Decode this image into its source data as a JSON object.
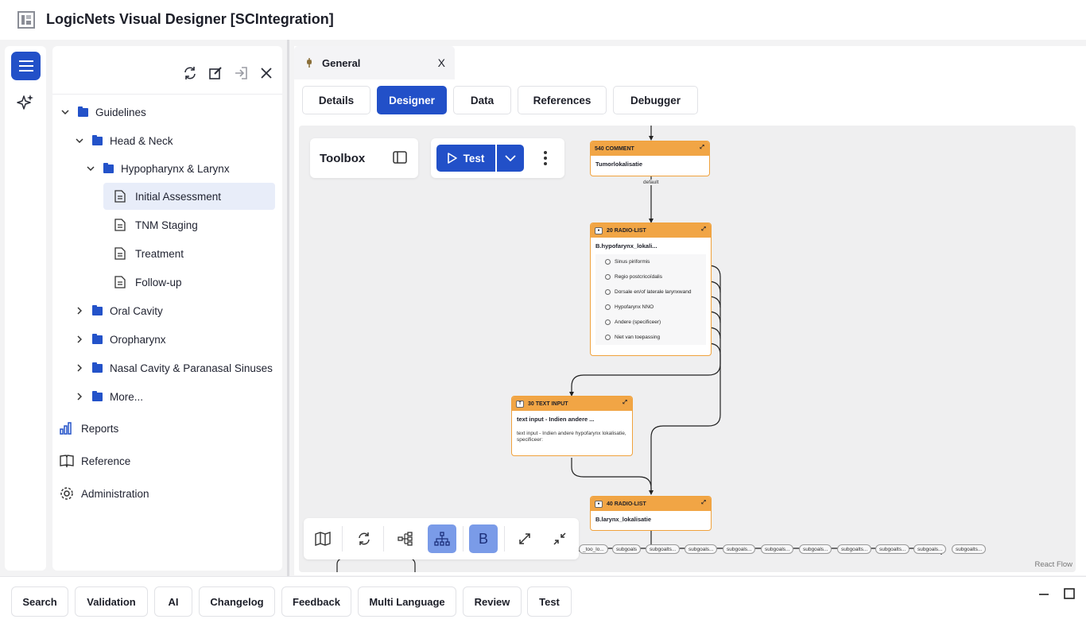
{
  "app": {
    "title": "LogicNets Visual Designer [SCIntegration]",
    "accent_color": "#2250c8",
    "node_color": "#f1a545"
  },
  "rail": {
    "menu_icon": "hamburger-icon",
    "assistant_icon": "sparkle-icon"
  },
  "tree": {
    "actions": [
      "refresh-icon",
      "edit-icon",
      "sign-in-icon",
      "close-icon"
    ],
    "items": [
      {
        "label": "Guidelines",
        "type": "folder",
        "expanded": true,
        "level": 0
      },
      {
        "label": "Head & Neck",
        "type": "folder",
        "expanded": true,
        "level": 1
      },
      {
        "label": "Hypopharynx & Larynx",
        "type": "folder",
        "expanded": true,
        "level": 2
      },
      {
        "label": "Initial Assessment",
        "type": "document",
        "selected": true,
        "level": 3
      },
      {
        "label": "TNM Staging",
        "type": "document",
        "level": 3
      },
      {
        "label": "Treatment",
        "type": "document",
        "level": 3
      },
      {
        "label": "Follow-up",
        "type": "document",
        "level": 3
      },
      {
        "label": "Oral Cavity",
        "type": "folder",
        "expanded": false,
        "level": 1
      },
      {
        "label": "Oropharynx",
        "type": "folder",
        "expanded": false,
        "level": 1
      },
      {
        "label": "Nasal Cavity & Paranasal Sinuses",
        "type": "folder",
        "expanded": false,
        "level": 1
      },
      {
        "label": "More...",
        "type": "folder",
        "expanded": false,
        "level": 1
      }
    ],
    "nav": [
      {
        "label": "Reports",
        "icon": "bar-chart-icon"
      },
      {
        "label": "Reference",
        "icon": "book-icon"
      },
      {
        "label": "Administration",
        "icon": "gear-icon"
      }
    ]
  },
  "editor": {
    "doc_tab": {
      "label": "General",
      "close": "X"
    },
    "subtabs": [
      {
        "label": "Details",
        "active": false
      },
      {
        "label": "Designer",
        "active": true
      },
      {
        "label": "Data",
        "active": false
      },
      {
        "label": "References",
        "active": false
      },
      {
        "label": "Debugger",
        "active": false
      }
    ],
    "toolbox": {
      "label": "Toolbox"
    },
    "test_button": {
      "label": "Test"
    },
    "nodes": {
      "comment": {
        "header": "540 COMMENT",
        "title": "Tumorlokalisatie"
      },
      "radio1": {
        "header": "20 RADIO-LIST",
        "title": "B.hypofarynx_lokali...",
        "options": [
          "Sinus piriformis",
          "Regio postcricoïdalis",
          "Dorsale en/of laterale larynxwand",
          "Hypofarynx NNO",
          "Andere (specificeer)",
          "Niet van toepassing"
        ]
      },
      "textinput": {
        "header": "30 TEXT INPUT",
        "title": "text input - Indien andere ...",
        "description": "text input - Indien andere hypofarynx lokalisatie, specificeer:"
      },
      "radio2": {
        "header": "40 RADIO-LIST",
        "title": "B.larynx_lokalisatie"
      }
    },
    "edge_label": "default",
    "subgoals": [
      "_too_lo...",
      "subgoals",
      "subgoalts...",
      "subgoals...",
      "subgoals...",
      "subgoals...",
      "subgoals...",
      "subgoalts...",
      "subgoalts...",
      "subgoals...",
      "subgoalts..."
    ],
    "watermark": "React Flow",
    "zoom_tools": [
      "map-icon",
      "refresh-icon",
      "hierarchy-icon",
      "tree-layout-icon",
      "B",
      "expand-icon",
      "collapse-icon"
    ]
  },
  "bottom": {
    "buttons": [
      "Search",
      "Validation",
      "AI",
      "Changelog",
      "Feedback",
      "Multi Language",
      "Review",
      "Test"
    ]
  }
}
